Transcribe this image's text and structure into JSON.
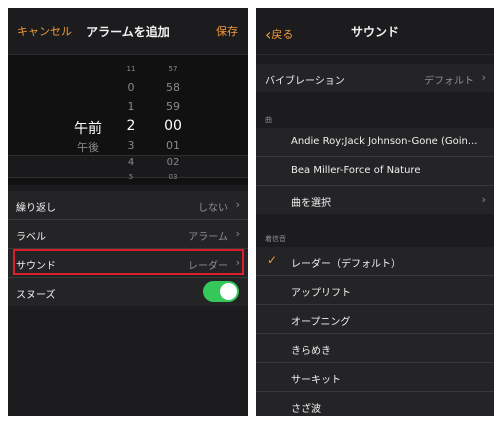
{
  "left": {
    "cancel_label": "キャンセル",
    "title": "アラームを追加",
    "save_label": "保存",
    "picker": {
      "ampm": {
        "selected": "午前",
        "other": "午後"
      },
      "hours": [
        "0",
        "1",
        "2",
        "3",
        "4",
        "5"
      ],
      "selected_hour": "2",
      "minutes": [
        "57",
        "58",
        "59",
        "00",
        "01",
        "02",
        "03"
      ],
      "selected_minute": "00",
      "top_hour": "11"
    },
    "rows": {
      "repeat": {
        "label": "繰り返し",
        "value": "しない"
      },
      "label": {
        "label": "ラベル",
        "value": "アラーム"
      },
      "sound": {
        "label": "サウンド",
        "value": "レーダー"
      },
      "snooze": {
        "label": "スヌーズ",
        "on": true
      }
    },
    "chevron": "›"
  },
  "right": {
    "back_label": "戻る",
    "back_icon": "‹",
    "title": "サウンド",
    "vibration": {
      "label": "バイブレーション",
      "value": "デフォルト"
    },
    "songs_header": "曲",
    "songs": [
      "Andie Roy;Jack Johnson-Gone (Goin...",
      "Bea Miller-Force of Nature",
      "曲を選択"
    ],
    "ringtones_header": "着信音",
    "ringtones": [
      "レーダー（デフォルト）",
      "アップリフト",
      "オープニング",
      "きらめき",
      "サーキット",
      "さざ波"
    ],
    "check_icon": "✓",
    "chevron": "›"
  },
  "colors": {
    "accent": "#f19a38",
    "toggle_on": "#34c759",
    "highlight": "#d8202a",
    "background": "#1c1c1e"
  }
}
